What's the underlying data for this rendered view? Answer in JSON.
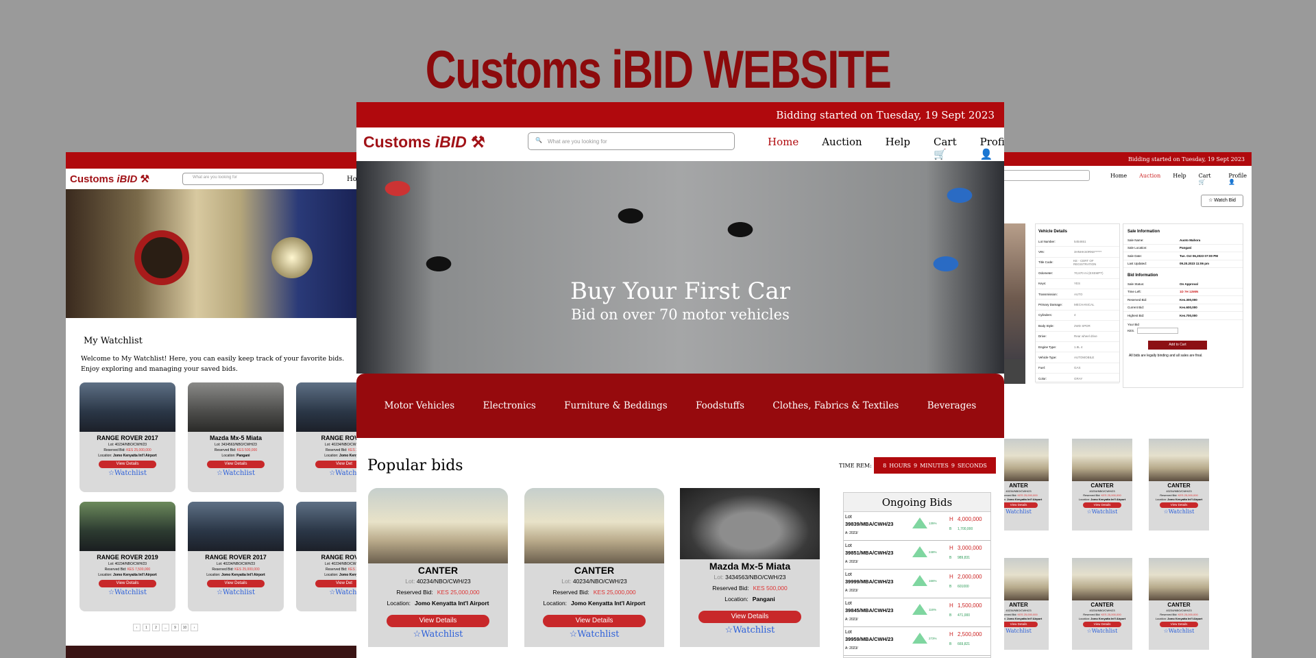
{
  "page": {
    "headline": "Customs iBID WEBSITE"
  },
  "brand": {
    "prefix": "Customs ",
    "mark": "iBID"
  },
  "left_panel": {
    "search_placeholder": "What are you looking for",
    "nav_link": "Ho",
    "watchlist_title": "My Watchlist",
    "watchlist_intro": "Welcome to My Watchlist! Here, you can easily keep track of your favorite bids. Enjoy exploring and managing your saved bids.",
    "cards": [
      {
        "title": "RANGE ROVER 2017",
        "lot": "Lot: 40234/NBO/CWH/23",
        "reserved_label": "Reserved Bid:",
        "reserved": "KES 25,000,000",
        "location_label": "Location:",
        "location": "Jomo Kenyatta Int'l Airport",
        "button": "View Details",
        "watch": "☆Watchlist"
      },
      {
        "title": "Mazda Mx-5 Miata",
        "lot": "Lot: 3434563/NBO/CWH/23",
        "reserved_label": "Reserved Bid:",
        "reserved": "KES 500,000",
        "location_label": "Location:",
        "location": "Pangani",
        "button": "View Details",
        "watch": "☆Watchlist"
      },
      {
        "title": "RANGE ROVER",
        "lot": "Lot: 40234/NBO/CWH/23",
        "reserved_label": "Reserved Bid:",
        "reserved": "KES 25,0",
        "location_label": "Location:",
        "location": "Jomo Kenyatta",
        "button": "View Det",
        "watch": "☆Watchl"
      },
      {
        "title": "RANGE ROVER 2019",
        "lot": "Lot: 40234/NBO/CWH/23",
        "reserved_label": "Reserved Bid:",
        "reserved": "KES 7,500,000",
        "location_label": "Location:",
        "location": "Jomo Kenyatta Int'l Airport",
        "button": "View Details",
        "watch": "☆Watchlist"
      },
      {
        "title": "RANGE ROVER 2017",
        "lot": "Lot: 40234/NBO/CWH/23",
        "reserved_label": "Reserved Bid:",
        "reserved": "KES 25,000,000",
        "location_label": "Location:",
        "location": "Jomo Kenyatta Int'l Airport",
        "button": "View Details",
        "watch": "☆Watchlist"
      },
      {
        "title": "RANGE ROVER",
        "lot": "Lot: 40234/NBO/CWH/23",
        "reserved_label": "Reserved Bid:",
        "reserved": "KES 25,0",
        "location_label": "Location:",
        "location": "Jomo Kenyatta",
        "button": "View Det",
        "watch": "☆Watchl"
      }
    ],
    "pager": [
      "‹",
      "1",
      "2",
      "...",
      "9",
      "10",
      "›"
    ]
  },
  "center_panel": {
    "banner_text": "Bidding started on Tuesday, 19 Sept 2023",
    "search_placeholder": "What are you looking for",
    "nav": {
      "home": "Home",
      "auction": "Auction",
      "help": "Help",
      "cart": "Cart",
      "profile": "Profile"
    },
    "hero": {
      "title": "Buy Your First Car",
      "subtitle": "Bid on over 70  motor vehicles"
    },
    "categories": [
      "Motor Vehicles",
      "Electronics",
      "Furniture & Beddings",
      "Foodstuffs",
      "Clothes, Fabrics & Textiles",
      "Beverages"
    ],
    "popular_title": "Popular bids",
    "time_rem_label": "TIME REM:",
    "timer": {
      "hours": "8",
      "hours_label": "HOURS",
      "minutes": "9",
      "minutes_label": "MINUTES",
      "seconds": "9",
      "seconds_label": "SECONDS"
    },
    "cards": [
      {
        "title": "CANTER",
        "lot_label": "Lot:",
        "lot": "40234/NBO/CWH/23",
        "reserved_label": "Reserved Bid:",
        "reserved": "KES 25,000,000",
        "location_label": "Location:",
        "location": "Jomo Kenyatta Int'l Airport",
        "button": "View Details",
        "watch": "☆Watchlist"
      },
      {
        "title": "CANTER",
        "lot_label": "Lot:",
        "lot": "40234/NBO/CWH/23",
        "reserved_label": "Reserved Bid:",
        "reserved": "KES 25,000,000",
        "location_label": "Location:",
        "location": "Jomo Kenyatta Int'l Airport",
        "button": "View Details",
        "watch": "☆Watchlist"
      },
      {
        "title": "Mazda Mx-5 Miata",
        "lot_label": "Lot:",
        "lot": "3434563/NBO/CWH/23",
        "reserved_label": "Reserved Bid:",
        "reserved": "KES 500,000",
        "location_label": "Location:",
        "location": "Pangani",
        "button": "View Details",
        "watch": "☆Watchlist"
      }
    ],
    "ongoing_title": "Ongoing Bids",
    "ongoing": [
      {
        "lot": "Lot",
        "id": "39839/MBA/CWH/23",
        "a": "A: 2023/",
        "pct": "135%",
        "high_label": "H",
        "high": "4,000,000",
        "low_label": "B",
        "low": "1,700,000"
      },
      {
        "lot": "Lot",
        "id": "39851/MBA/CWH/23",
        "a": "A: 2023/",
        "pct": "248%",
        "high_label": "H",
        "high": "3,000,000",
        "low_label": "B",
        "low": "989,831"
      },
      {
        "lot": "Lot",
        "id": "39999/MBA/CWH/23",
        "a": "A: 2023/",
        "pct": "166%",
        "high_label": "H",
        "high": "2,000,000",
        "low_label": "B",
        "low": "601000"
      },
      {
        "lot": "Lot",
        "id": "39845/MBA/CWH/23",
        "a": "A: 2023/",
        "pct": "116%",
        "high_label": "H",
        "high": "1,500,000",
        "low_label": "B",
        "low": "471,000"
      },
      {
        "lot": "Lot",
        "id": "39959/MBA/CWH/23",
        "a": "A: 2023/",
        "pct": "273%",
        "high_label": "H",
        "high": "2,500,000",
        "low_label": "B",
        "low": "669,821"
      }
    ]
  },
  "right_panel": {
    "banner_text": "Bidding started on Tuesday, 19 Sept 2023",
    "nav": {
      "home": "Home",
      "auction": "Auction",
      "help": "Help",
      "cart": "Cart",
      "profile": "Profile"
    },
    "watch_bid": "☆ Watch Bid",
    "vehicle_details_title": "Vehicle Details",
    "vehicle_details": [
      {
        "k": "Lot Number:",
        "v": "5454651"
      },
      {
        "k": "VIN:",
        "v": "3HNHKS0RN5******"
      },
      {
        "k": "Title Code:",
        "v": "KE - CERT OF REGISTRATION"
      },
      {
        "k": "Odometer:",
        "v": "70,670 mi (EXEMPT)"
      },
      {
        "k": "Keys:",
        "v": "YES"
      },
      {
        "k": "Transmission:",
        "v": "AUTO"
      },
      {
        "k": "Primary Damage:",
        "v": "MECHANICAL"
      },
      {
        "k": "Cylinders:",
        "v": "4"
      },
      {
        "k": "Body Style:",
        "v": "2WD SPDR"
      },
      {
        "k": "Drive:",
        "v": "Rear wheel drive"
      },
      {
        "k": "Engine Type:",
        "v": "1.8L 4"
      },
      {
        "k": "Vehicle Type:",
        "v": "AUTOMOBILE"
      },
      {
        "k": "Fuel:",
        "v": "GAS"
      },
      {
        "k": "Color:",
        "v": "GRAY"
      }
    ],
    "sale_info_title": "Sale Information",
    "sale_info": [
      {
        "k": "Sale Name:",
        "v": "Auoto Mahora"
      },
      {
        "k": "Sale Location:",
        "v": "Pangani"
      },
      {
        "k": "Sale Date:",
        "v": "Tue. Oct 06,2023 07:00 PM"
      },
      {
        "k": "Last Updated:",
        "v": "09.20.2023 11:06 pm"
      }
    ],
    "bid_info_title": "Bid Information",
    "bid_info": [
      {
        "k": "Sale Status:",
        "v": "On Approval",
        "red": false
      },
      {
        "k": "Time Left:",
        "v": "1D 7H 12MIN",
        "red": true
      },
      {
        "k": "Reserved Bid:",
        "v": "Kes.300,000",
        "red": false
      },
      {
        "k": "Current Bid:",
        "v": "Kes.600,000",
        "red": false
      },
      {
        "k": "Highest Bid:",
        "v": "Kes.700,000",
        "red": false
      }
    ],
    "your_bid": "Your Bid",
    "kes": "KES.",
    "add_to_cart": "Add to Cart",
    "note": "All bids are legally binding and all sales are final.",
    "cards": [
      {
        "title": "ANTER",
        "lot": "40234/NBO/CWH/23",
        "reserved_label": "Reserved Bid:",
        "reserved": "KES 25,000,000",
        "location_label": "Location:",
        "location": "Jomo Kenyatta Int'l Airport",
        "button": "View Details",
        "watch": "Watchlist"
      },
      {
        "title": "CANTER",
        "lot": "40234/NBO/CWH/23",
        "reserved_label": "Reserved Bid:",
        "reserved": "KES 25,000,000",
        "location_label": "Location:",
        "location": "Jomo Kenyatta Int'l Airport",
        "button": "View Details",
        "watch": "☆Watchlist"
      },
      {
        "title": "CANTER",
        "lot": "40234/NBO/CWH/23",
        "reserved_label": "Reserved Bid:",
        "reserved": "KES 25,000,000",
        "location_label": "Location:",
        "location": "Jomo Kenyatta Int'l Airport",
        "button": "View Details",
        "watch": "☆Watchlist"
      },
      {
        "title": "ANTER",
        "lot": "40234/NBO/CWH/23",
        "reserved_label": "Reserved Bid:",
        "reserved": "KES 25,000,000",
        "location_label": "Location:",
        "location": "Jomo Kenyatta Int'l Airport",
        "button": "View Details",
        "watch": "Watchlist"
      },
      {
        "title": "CANTER",
        "lot": "40234/NBO/CWH/23",
        "reserved_label": "Reserved Bid:",
        "reserved": "KES 25,000,000",
        "location_label": "Location:",
        "location": "Jomo Kenyatta Int'l Airport",
        "button": "View Details",
        "watch": "☆Watchlist"
      },
      {
        "title": "CANTER",
        "lot": "40234/NBO/CWH/23",
        "reserved_label": "Reserved Bid:",
        "reserved": "KES 25,000,000",
        "location_label": "Location:",
        "location": "Jomo Kenyatta Int'l Airport",
        "button": "View Details",
        "watch": "☆Watchlist"
      }
    ]
  }
}
